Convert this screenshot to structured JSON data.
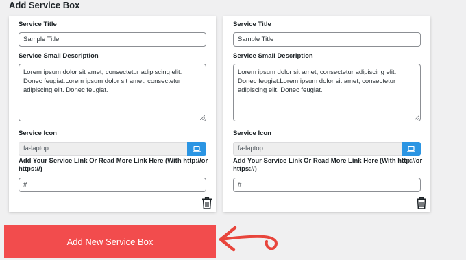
{
  "section": {
    "title": "Add Service Box"
  },
  "labels": {
    "service_title": "Service Title",
    "service_description": "Service Small Description",
    "service_icon": "Service Icon",
    "service_link": "Add Your Service Link Or Read More Link Here (With http://or https://)"
  },
  "service_boxes": [
    {
      "title_value": "Sample Title",
      "description_value": "Lorem ipsum dolor sit amet, consectetur adipiscing elit. Donec feugiat.Lorem ipsum dolor sit amet, consectetur adipiscing elit. Donec feugiat.",
      "icon_value": "fa-laptop",
      "link_value": "#"
    },
    {
      "title_value": "Sample Title",
      "description_value": "Lorem ipsum dolor sit amet, consectetur adipiscing elit. Donec feugiat.Lorem ipsum dolor sit amet, consectetur adipiscing elit. Donec feugiat.",
      "icon_value": "fa-laptop",
      "link_value": "#"
    }
  ],
  "add_button": {
    "label": "Add New Service Box"
  },
  "icons": {
    "icon_picker": "laptop-icon",
    "delete": "trash-icon",
    "pointer": "hand-drawn-arrow"
  },
  "colors": {
    "add_button_bg": "#f24c4d",
    "icon_button_bg": "#2b95e3",
    "arrow": "#e8453c"
  }
}
